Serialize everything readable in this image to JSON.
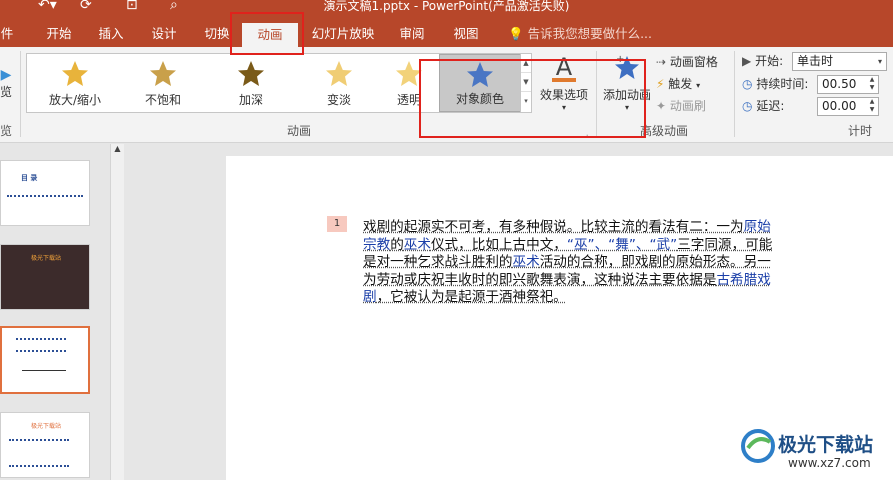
{
  "window": {
    "title": "演示文稿1.pptx - PowerPoint(产品激活失败)"
  },
  "tabs": [
    "件",
    "开始",
    "插入",
    "设计",
    "切换",
    "动画",
    "幻灯片放映",
    "审阅",
    "视图"
  ],
  "active_tab": "动画",
  "tell_me": "告诉我您想要做什么...",
  "ribbon": {
    "preview_label": "览",
    "animations": [
      {
        "label": "放大/缩小",
        "color": "#e8b33b"
      },
      {
        "label": "不饱和",
        "color": "#c9a04a"
      },
      {
        "label": "加深",
        "color": "#7a5a18"
      },
      {
        "label": "变淡",
        "color": "#f0cd74"
      },
      {
        "label": "透明",
        "color": "#f2d27a"
      },
      {
        "label": "对象颜色",
        "color": "#4a76c4"
      }
    ],
    "effect_options": "效果选项",
    "add_animation": "添加动画",
    "animation_pane": "动画窗格",
    "trigger": "触发",
    "anim_painter": "动画刷",
    "start_label": "开始:",
    "start_value": "单击时",
    "duration_label": "持续时间:",
    "duration_value": "00.50",
    "delay_label": "延迟:",
    "delay_value": "00.00",
    "group_animation": "动画",
    "group_advanced": "高级动画",
    "group_timing": "计时",
    "group_preview": "览"
  },
  "slide": {
    "anim_index": "1",
    "text_parts": [
      {
        "t": "戏剧的起源实不可考，有多种假说。比较主流的看法有二：一为",
        "link": false
      },
      {
        "t": "原始宗教",
        "link": true
      },
      {
        "t": "的",
        "link": false
      },
      {
        "t": "巫术",
        "link": true
      },
      {
        "t": "仪式，比如上古中文，",
        "link": false
      },
      {
        "t": "“巫”、“舞”、“武”",
        "link": true
      },
      {
        "t": "三字同源，可能是对一种乞求战斗胜利的",
        "link": false
      },
      {
        "t": "巫术",
        "link": true
      },
      {
        "t": "活动的合称，即戏剧的原始形态。另一为劳动或庆祝丰收时的即兴歌舞表演，这种说法主要依据是",
        "link": false
      },
      {
        "t": "古希腊戏剧",
        "link": true
      },
      {
        "t": "，它被认为是起源于酒神祭祀。",
        "link": false
      }
    ]
  },
  "thumbnails": [
    {
      "title": "目 录"
    },
    {
      "title": "极光下载站"
    },
    {
      "title": ""
    },
    {
      "title": "极光下载站"
    }
  ],
  "watermark": {
    "name": "极光下载站",
    "url": "www.xz7.com"
  },
  "colors": {
    "accent": "#b7472a",
    "annotation": "#e0221c",
    "link": "#1a3ea8"
  }
}
